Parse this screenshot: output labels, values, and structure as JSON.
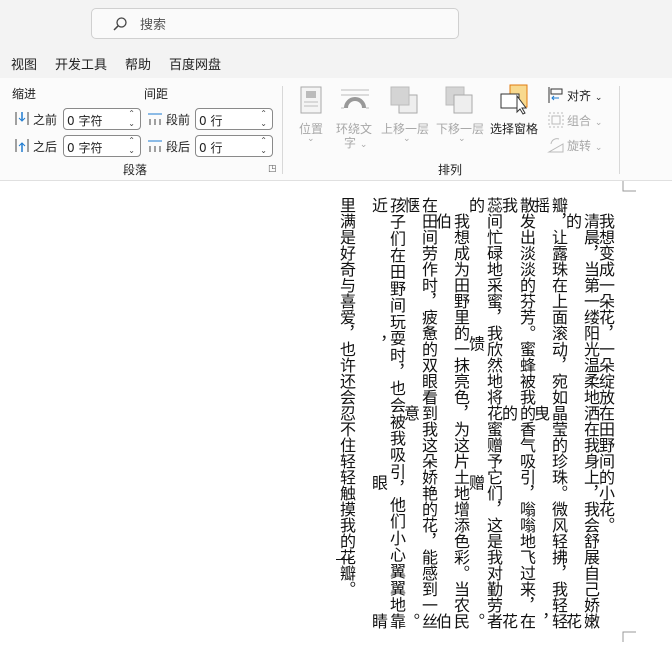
{
  "search": {
    "placeholder": "搜索"
  },
  "menu": [
    "视图",
    "开发工具",
    "帮助",
    "百度网盘"
  ],
  "paragraph": {
    "indent_label": "缩进",
    "spacing_label": "间距",
    "before_label": "之前",
    "after_label": "之后",
    "before_value": "0 字符",
    "after_value": "0 字符",
    "para_before_label": "段前",
    "para_after_label": "段后",
    "para_before_value": "0 行",
    "para_after_value": "0 行",
    "group_label": "段落"
  },
  "arrange": {
    "position": "位置",
    "wrap_text_1": "环绕文",
    "wrap_text_2": "字",
    "bring_forward": "上移一层",
    "send_backward": "下移一层",
    "selection_pane": "选择窗格",
    "align": "对齐",
    "group": "组合",
    "rotate": "旋转",
    "group_label": "排列"
  },
  "document": {
    "lines": [
      "我想变成一朵花，一朵绽放在田野间的小花。",
      "清晨，当第一缕阳光温柔地洒在我身上，我会舒展自己娇嫩的花",
      "瓣，让露珠在上面滚动，宛如晶莹的珍珠。微风轻拂，我轻轻摇曳，",
      "散发出淡淡的芬芳。蜜蜂被我的香气吸引，嗡嗡地飞过来，在我的花",
      "蕊间忙碌地采蜜，我欣然地将花蜜赠予它们，这是我对勤劳者的馈赠。",
      "我想成为田野里的一抹亮色，为这片土地增添色彩。当农民伯伯",
      "在田间劳作时，疲惫的双眼看到我这朵娇艳的花，能感到一丝惬意。",
      "孩子们在田野间玩耍时，也会被我吸引，他们小心翼翼地靠近，眼睛",
      "里满是好奇与喜爱，也许还会忍不住轻轻触摸我的花瓣。"
    ]
  }
}
